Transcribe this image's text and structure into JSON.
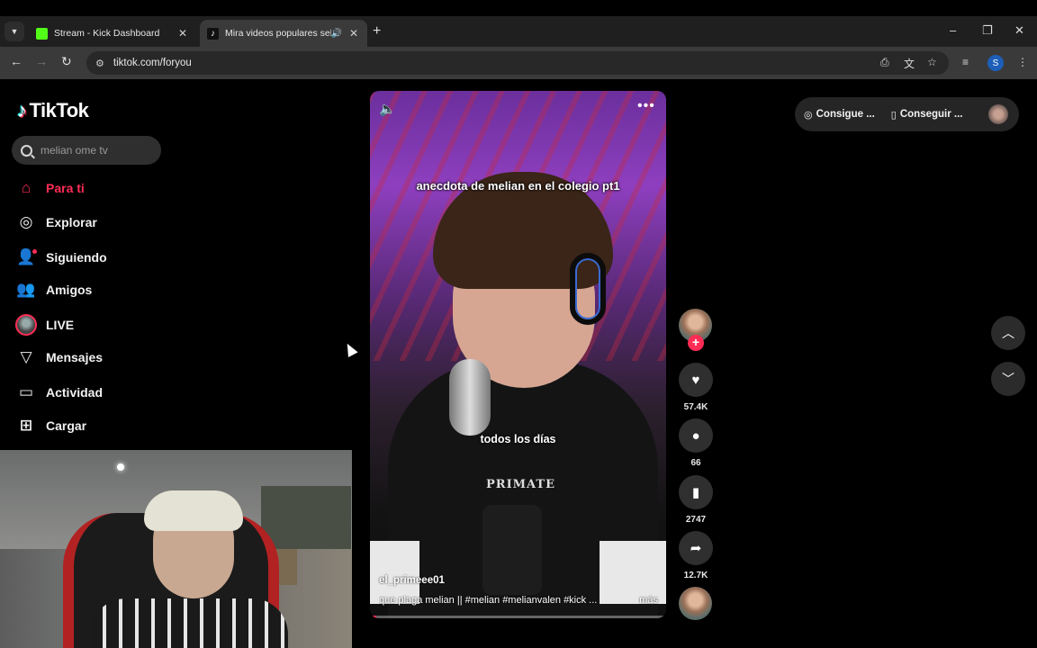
{
  "browser": {
    "tabs": [
      {
        "title": "Stream - Kick Dashboard",
        "favicon_color": "#53fc18",
        "active": false
      },
      {
        "title": "Mira videos populares sele",
        "favicon_color": "#111111",
        "active": true,
        "audio": true
      }
    ],
    "url": "tiktok.com/foryou",
    "profile_initial": "S"
  },
  "sidebar": {
    "logo": "TikTok",
    "search_value": "melian ome tv",
    "items": [
      {
        "label": "Para ti",
        "icon": "home-icon",
        "active": true
      },
      {
        "label": "Explorar",
        "icon": "compass-icon"
      },
      {
        "label": "Siguiendo",
        "icon": "user-follow-icon"
      },
      {
        "label": "Amigos",
        "icon": "friends-icon"
      },
      {
        "label": "LIVE",
        "icon": "live-icon"
      },
      {
        "label": "Mensajes",
        "icon": "send-icon"
      },
      {
        "label": "Actividad",
        "icon": "inbox-icon"
      },
      {
        "label": "Cargar",
        "icon": "upload-icon"
      }
    ]
  },
  "video": {
    "caption_top": "anecdota de melian en el colegio pt1",
    "caption_mid": "todos los días",
    "shirt_text": "PRIMATE",
    "username": "el_primeee01",
    "description": "que plaga melian || #melian  #melianvalen  #kick ...",
    "more": "más",
    "progress": 0.02
  },
  "actions": {
    "likes": "57.4K",
    "comments": "66",
    "saves": "2747",
    "shares": "12.7K"
  },
  "top_right": {
    "coins_label": "Consigue ...",
    "app_label": "Conseguir ..."
  },
  "colors": {
    "accent": "#fe2c55",
    "background": "#000000"
  }
}
